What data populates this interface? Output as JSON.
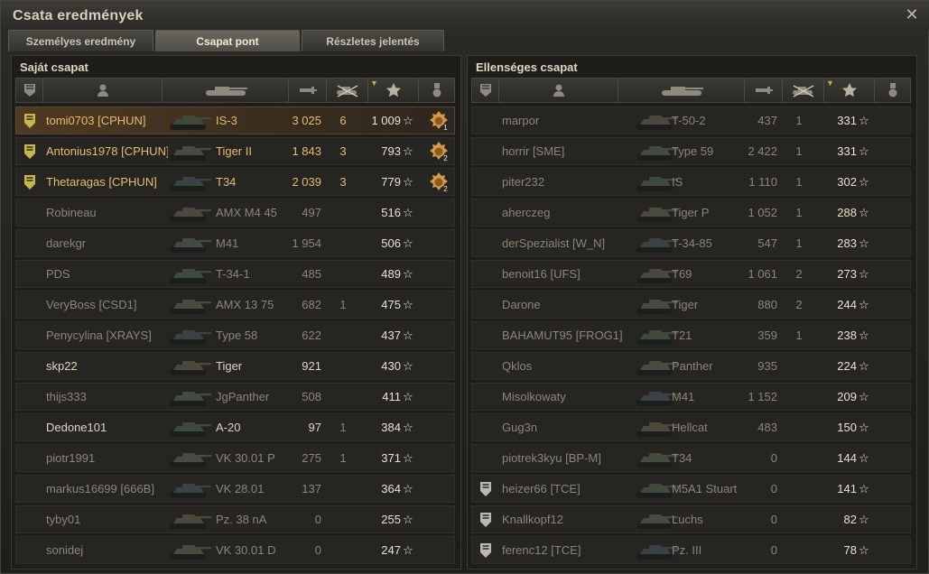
{
  "window": {
    "title": "Csata eredmények",
    "close_symbol": "✕"
  },
  "tabs": [
    {
      "label": "Személyes eredmény",
      "active": false
    },
    {
      "label": "Csapat pont",
      "active": true
    },
    {
      "label": "Részletes jelentés",
      "active": false
    }
  ],
  "columns": [
    "squad-icon",
    "player-icon",
    "tank-icon",
    "damage-icon",
    "kills-icon",
    "xp-star-icon",
    "medal-icon"
  ],
  "sorted_column": "xp",
  "star_symbol": "☆",
  "own_team": {
    "title": "Saját csapat",
    "rows": [
      {
        "name": "tomi0703 [CPHUN]",
        "vehicle": "IS-3",
        "damage": "3 025",
        "kills": "6",
        "xp": "1 009",
        "squad": true,
        "me": true,
        "medal": "1"
      },
      {
        "name": "Antonius1978 [CPHUN]",
        "vehicle": "Tiger II",
        "damage": "1 843",
        "kills": "3",
        "xp": "793",
        "squad": true,
        "me": false,
        "medal": "2"
      },
      {
        "name": "Thetaragas [CPHUN]",
        "vehicle": "T34",
        "damage": "2 039",
        "kills": "3",
        "xp": "779",
        "squad": true,
        "me": false,
        "medal": "2"
      },
      {
        "name": "Robineau",
        "vehicle": "AMX M4 45",
        "damage": "497",
        "kills": "",
        "xp": "516"
      },
      {
        "name": "darekgr",
        "vehicle": "M41",
        "damage": "1 954",
        "kills": "",
        "xp": "506"
      },
      {
        "name": "PDS",
        "vehicle": "T-34-1",
        "damage": "485",
        "kills": "",
        "xp": "489"
      },
      {
        "name": "VeryBoss [CSD1]",
        "vehicle": "AMX 13 75",
        "damage": "682",
        "kills": "1",
        "xp": "475"
      },
      {
        "name": "Penycylina [XRAYS]",
        "vehicle": "Type 58",
        "damage": "622",
        "kills": "",
        "xp": "437"
      },
      {
        "name": "skp22",
        "vehicle": "Tiger",
        "damage": "921",
        "kills": "",
        "xp": "430",
        "alive": true
      },
      {
        "name": "thijs333",
        "vehicle": "JgPanther",
        "damage": "508",
        "kills": "",
        "xp": "411"
      },
      {
        "name": "Dedone101",
        "vehicle": "A-20",
        "damage": "97",
        "kills": "1",
        "xp": "384",
        "alive": true
      },
      {
        "name": "piotr1991",
        "vehicle": "VK 30.01 P",
        "damage": "275",
        "kills": "1",
        "xp": "371"
      },
      {
        "name": "markus16699 [666B]",
        "vehicle": "VK 28.01",
        "damage": "137",
        "kills": "",
        "xp": "364"
      },
      {
        "name": "tyby01",
        "vehicle": "Pz. 38 nA",
        "damage": "0",
        "kills": "",
        "xp": "255"
      },
      {
        "name": "sonidej",
        "vehicle": "VK 30.01 D",
        "damage": "0",
        "kills": "",
        "xp": "247"
      }
    ]
  },
  "enemy_team": {
    "title": "Ellenséges csapat",
    "rows": [
      {
        "name": "marpor",
        "vehicle": "T-50-2",
        "damage": "437",
        "kills": "1",
        "xp": "331"
      },
      {
        "name": "horrir [SME]",
        "vehicle": "Type 59",
        "damage": "2 422",
        "kills": "1",
        "xp": "331"
      },
      {
        "name": "piter232",
        "vehicle": "IS",
        "damage": "1 110",
        "kills": "1",
        "xp": "302"
      },
      {
        "name": "aherczeg",
        "vehicle": "Tiger P",
        "damage": "1 052",
        "kills": "1",
        "xp": "288"
      },
      {
        "name": "derSpezialist [W_N]",
        "vehicle": "T-34-85",
        "damage": "547",
        "kills": "1",
        "xp": "283"
      },
      {
        "name": "benoit16 [UFS]",
        "vehicle": "T69",
        "damage": "1 061",
        "kills": "2",
        "xp": "273"
      },
      {
        "name": "Darone",
        "vehicle": "Tiger",
        "damage": "880",
        "kills": "2",
        "xp": "244"
      },
      {
        "name": "BAHAMUT95 [FROG1]",
        "vehicle": "T21",
        "damage": "359",
        "kills": "1",
        "xp": "238"
      },
      {
        "name": "Qklos",
        "vehicle": "Panther",
        "damage": "935",
        "kills": "",
        "xp": "224"
      },
      {
        "name": "Misolkowaty",
        "vehicle": "M41",
        "damage": "1 152",
        "kills": "",
        "xp": "209"
      },
      {
        "name": "Gug3n",
        "vehicle": "Hellcat",
        "damage": "483",
        "kills": "",
        "xp": "150"
      },
      {
        "name": "piotrek3kyu [BP-M]",
        "vehicle": "T34",
        "damage": "0",
        "kills": "",
        "xp": "144"
      },
      {
        "name": "heizer66 [TCE]",
        "vehicle": "M5A1 Stuart",
        "damage": "0",
        "kills": "",
        "xp": "141",
        "squad": true
      },
      {
        "name": "Knallkopf12",
        "vehicle": "Luchs",
        "damage": "0",
        "kills": "",
        "xp": "82",
        "squad": true
      },
      {
        "name": "ferenc12 [TCE]",
        "vehicle": "Pz. III",
        "damage": "0",
        "kills": "",
        "xp": "78",
        "squad": true
      }
    ]
  },
  "colors": {
    "own_squad": "#c7b64a",
    "enemy_squad": "#b8b8b8",
    "highlight": "#e6bd72"
  }
}
